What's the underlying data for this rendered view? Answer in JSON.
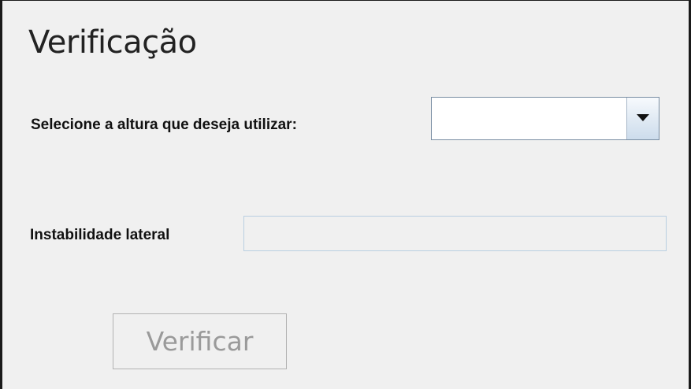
{
  "panel": {
    "title": "Verificação"
  },
  "altura": {
    "label": "Selecione a altura que deseja utilizar:",
    "selected": ""
  },
  "instabilidade": {
    "label": "Instabilidade lateral",
    "value": ""
  },
  "actions": {
    "verify_label": "Verificar",
    "verify_enabled": false
  },
  "icons": {
    "dropdown": "chevron-down-icon"
  }
}
